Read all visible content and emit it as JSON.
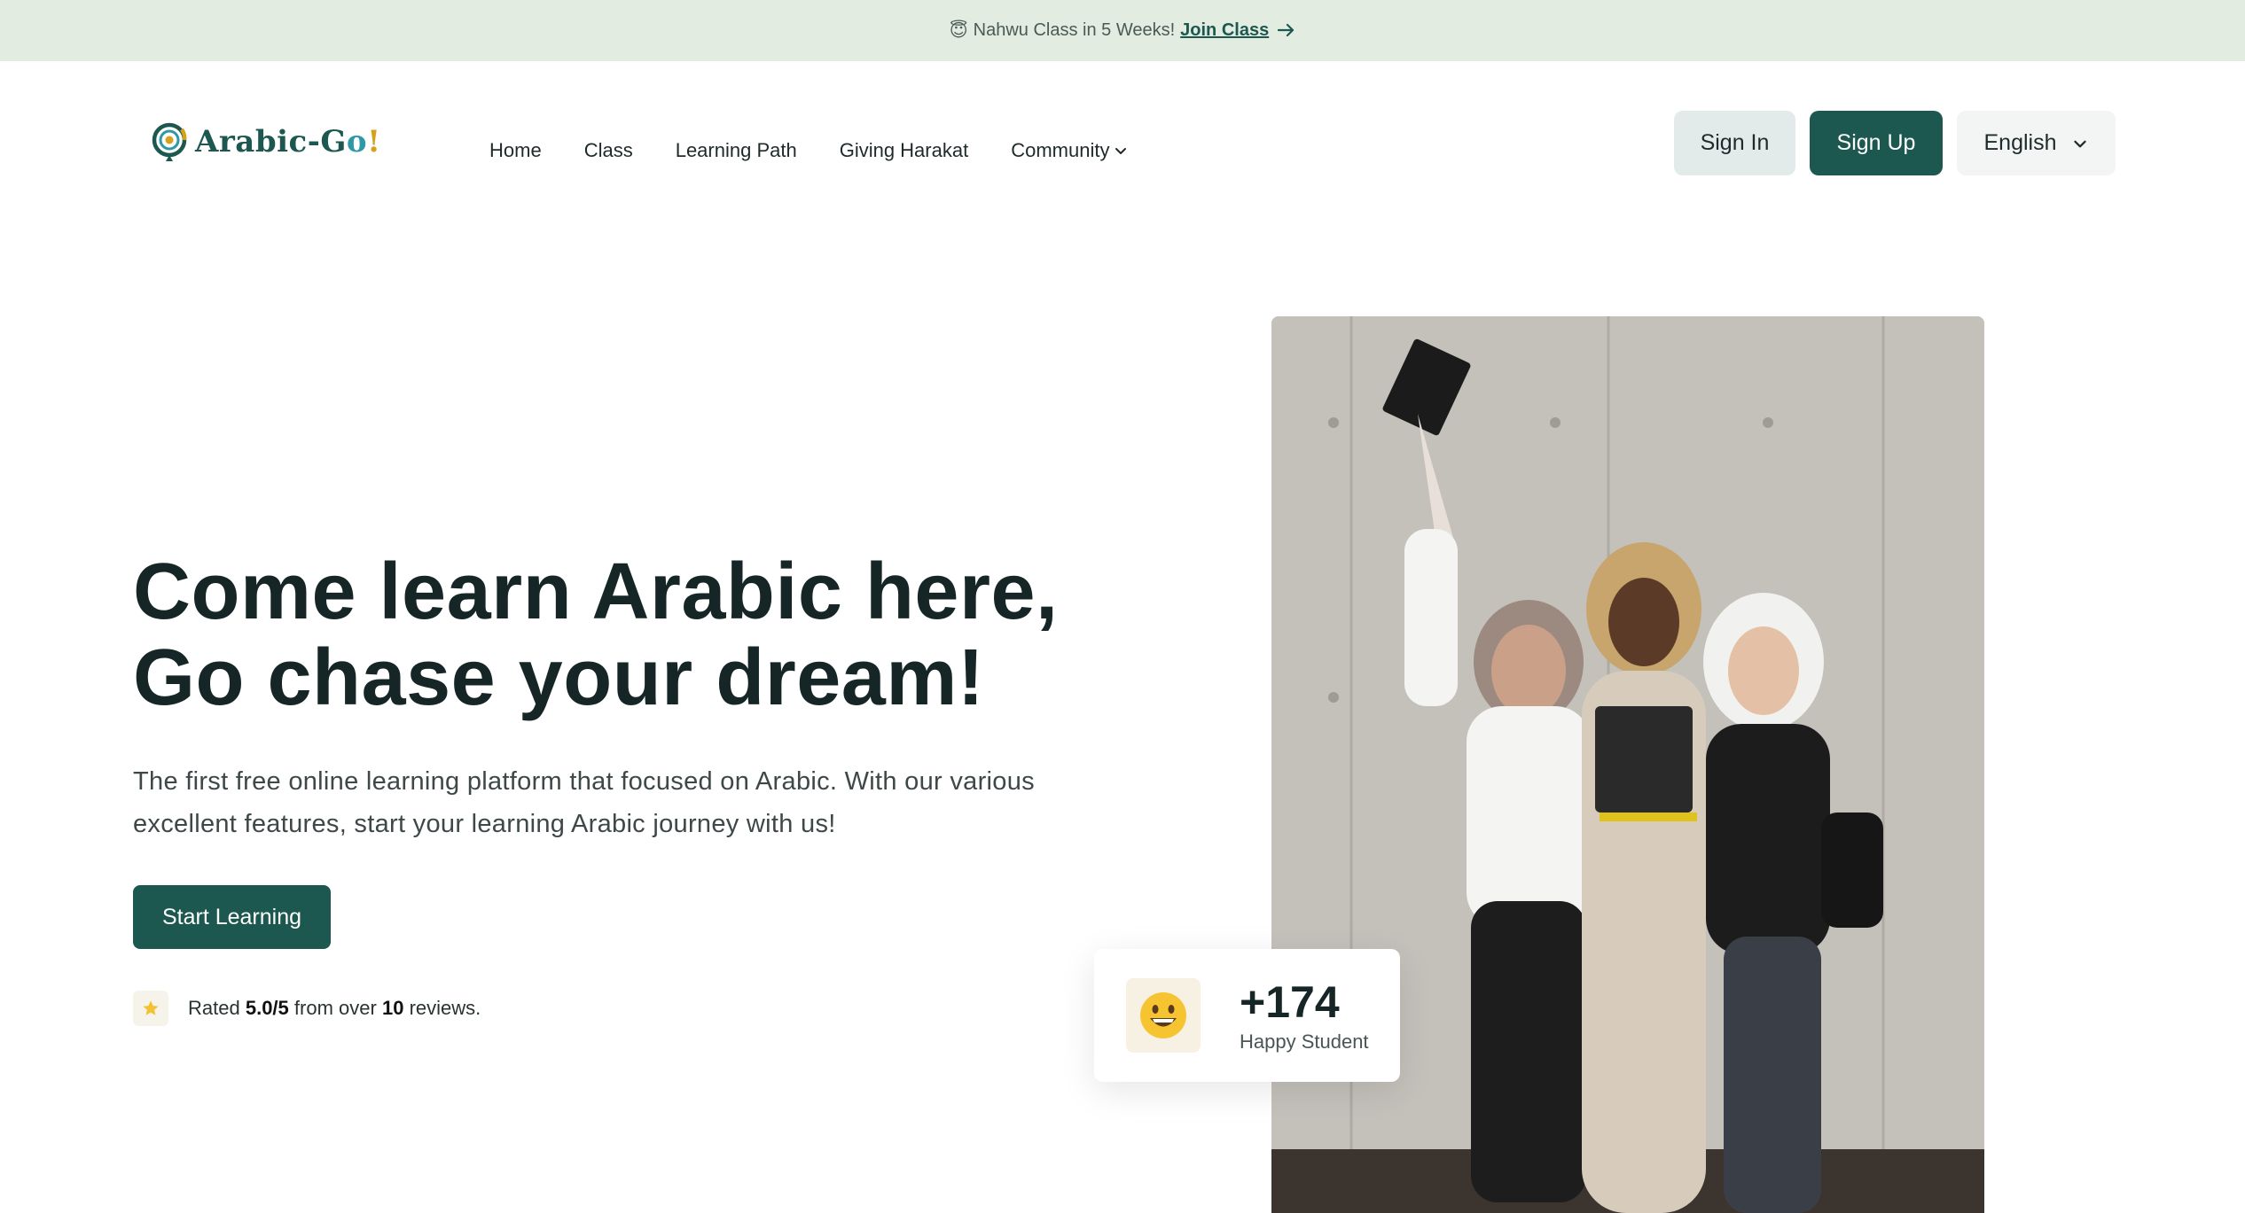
{
  "announcement": {
    "emoji": "😇",
    "text": "Nahwu Class in 5 Weeks!",
    "link": "Join Class",
    "arrow": "→"
  },
  "logo": {
    "part1": "Arabic-G",
    "part2": "o",
    "part3": "!"
  },
  "nav": {
    "home": "Home",
    "class": "Class",
    "learning_path": "Learning Path",
    "giving_harakat": "Giving Harakat",
    "community": "Community"
  },
  "actions": {
    "sign_in": "Sign In",
    "sign_up": "Sign Up",
    "language": "English"
  },
  "hero": {
    "title_line1": "Come learn Arabic here,",
    "title_line2": "Go chase your dream!",
    "description": "The first free online learning platform that focused on Arabic. With our various excellent features, start your learning Arabic journey with us!",
    "cta": "Start Learning"
  },
  "rating": {
    "prefix": "Rated",
    "score": "5.0/5",
    "middle": "from over",
    "count": "10",
    "suffix": "reviews."
  },
  "stat": {
    "emoji": "😀",
    "value": "+174",
    "label": "Happy Student"
  },
  "colors": {
    "brand": "#1d5850",
    "announce_bg": "#e3ece0",
    "signin_bg": "#e3ebea",
    "accent_gold": "#d6a21c"
  },
  "icons": {
    "logo": "compass-logo-icon",
    "dropdown": "chevron-down-icon",
    "arrow": "arrow-right-icon",
    "star": "star-icon"
  }
}
